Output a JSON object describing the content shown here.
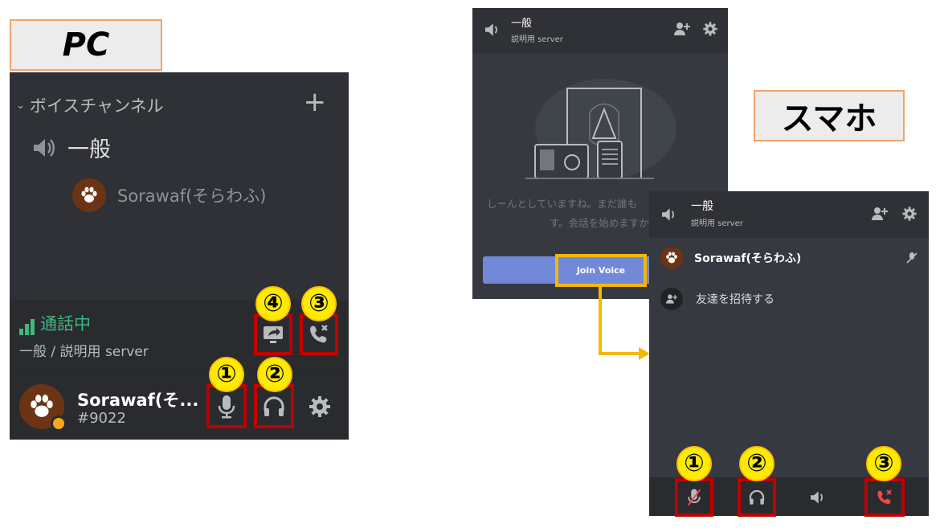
{
  "labels": {
    "pc": "PC",
    "smartphone": "スマホ"
  },
  "pc": {
    "category": "ボイスチャンネル",
    "channel": "一般",
    "member": "Sorawaf(そらわふ)",
    "status": {
      "connected": "通話中",
      "channel_server": "一般 / 説明用 server"
    },
    "user": {
      "name": "Sorawaf(そ...",
      "tag": "#9022"
    },
    "badges": [
      "①",
      "②",
      "③",
      "④"
    ]
  },
  "phone_pre_join": {
    "channel": "一般",
    "server": "説明用 server",
    "empty_message_line1": "しーんとしていますね。まだ誰も",
    "empty_message_line2": "す。会話を始めますか",
    "join_button": "Join Voice"
  },
  "phone_in_call": {
    "channel": "一般",
    "server": "説明用 server",
    "member": "Sorawaf(そらわふ)",
    "invite": "友達を招待する",
    "badges": [
      "①",
      "②",
      "③"
    ]
  },
  "colors": {
    "highlight_red": "#c00000",
    "badge_yellow": "#ffeb00",
    "arrow": "#f5b800",
    "connected_green": "#43b581",
    "blurple": "#7289da"
  }
}
